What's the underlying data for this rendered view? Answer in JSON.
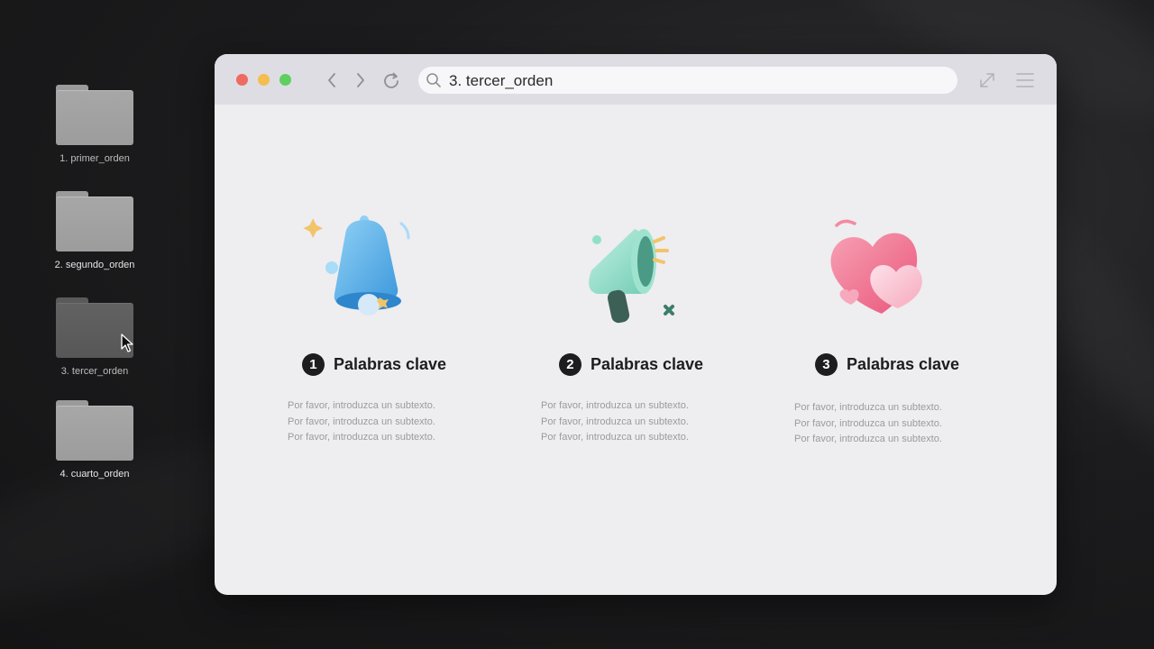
{
  "desktop": {
    "folders": [
      {
        "label": "1. primer_orden"
      },
      {
        "label": "2. segundo_orden"
      },
      {
        "label": "3. tercer_orden"
      },
      {
        "label": "4. cuarto_orden"
      }
    ]
  },
  "browser": {
    "address": "3. tercer_orden",
    "traffic_lights": {
      "close": "#ef6a62",
      "minimize": "#f3be4f",
      "maximize": "#5fcf60"
    },
    "icons": [
      "back-icon",
      "forward-icon",
      "reload-icon",
      "search-icon",
      "expand-icon",
      "menu-icon"
    ]
  },
  "cards": [
    {
      "number": "1",
      "title": "Palabras clave",
      "icon": "bell-icon",
      "subtexts": [
        "Por favor, introduzca un subtexto.",
        "Por favor, introduzca un subtexto.",
        "Por favor, introduzca un subtexto."
      ]
    },
    {
      "number": "2",
      "title": "Palabras clave",
      "icon": "megaphone-icon",
      "subtexts": [
        "Por favor, introduzca un subtexto.",
        "Por favor, introduzca un subtexto.",
        "Por favor, introduzca un subtexto."
      ]
    },
    {
      "number": "3",
      "title": "Palabras clave",
      "icon": "hearts-icon",
      "subtexts": [
        "Por favor, introduzca un subtexto.",
        "Por favor, introduzca un subtexto.",
        "Por favor, introduzca un subtexto."
      ]
    }
  ]
}
